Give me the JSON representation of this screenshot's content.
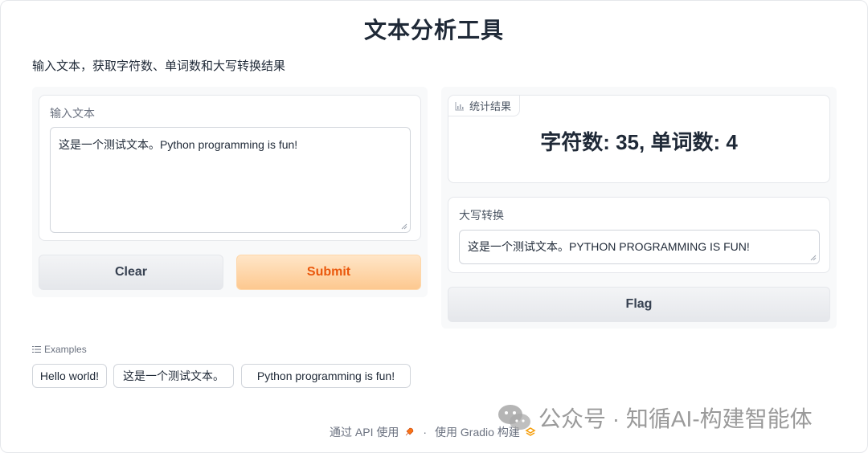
{
  "app": {
    "title": "文本分析工具",
    "description": "输入文本，获取字符数、单词数和大写转换结果"
  },
  "input": {
    "label": "输入文本",
    "value": "这是一个测试文本。Python programming is fun!"
  },
  "buttons": {
    "clear": "Clear",
    "submit": "Submit",
    "flag": "Flag"
  },
  "output": {
    "stats_label": "统计结果",
    "stats_value": "字符数: 35, 单词数: 4",
    "upper_label": "大写转换",
    "upper_value": "这是一个测试文本。PYTHON PROGRAMMING IS FUN!"
  },
  "examples": {
    "label": "Examples",
    "items": [
      "Hello world!",
      "这是一个测试文本。",
      "Python programming is fun!"
    ]
  },
  "footer": {
    "api": "通过 API 使用",
    "separator": "·",
    "built_with": "使用 Gradio 构建"
  },
  "watermark": {
    "text": "公众号 · 知循AI-构建智能体"
  }
}
